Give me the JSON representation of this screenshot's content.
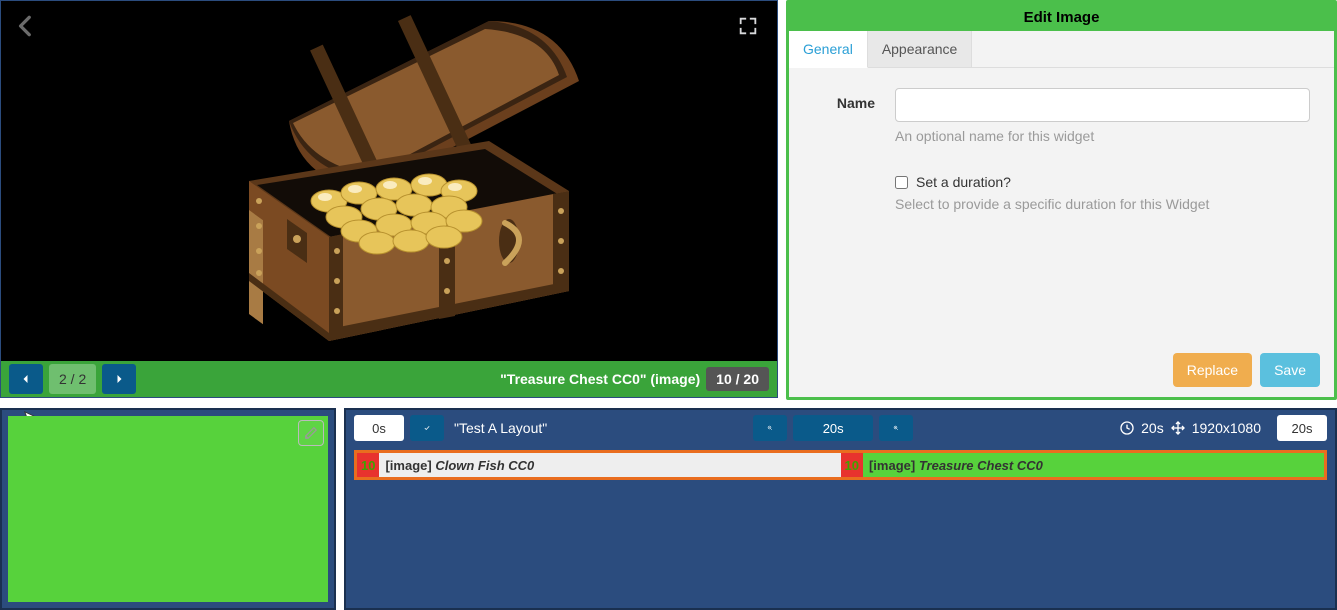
{
  "preview": {
    "page_indicator": "2 / 2",
    "item_title": "\"Treasure Chest CC0\" (image)",
    "item_count": "10 / 20"
  },
  "edit_panel": {
    "title": "Edit Image",
    "tabs": {
      "general": "General",
      "appearance": "Appearance"
    },
    "name_label": "Name",
    "name_value": "",
    "name_help": "An optional name for this widget",
    "duration_label": "Set a duration?",
    "duration_help": "Select to provide a specific duration for this Widget",
    "replace": "Replace",
    "save": "Save"
  },
  "timeline": {
    "start_time": "0s",
    "layout_title": "\"Test A Layout\"",
    "zoom_center": "20s",
    "total_duration": "20s",
    "resolution": "1920x1080",
    "end_time": "20s",
    "clips": [
      {
        "duration": "10",
        "type": "[image]",
        "name": "Clown Fish CC0",
        "active": false,
        "width_pct": 50
      },
      {
        "duration": "10",
        "type": "[image]",
        "name": "Treasure Chest CC0",
        "active": true,
        "width_pct": 50
      }
    ]
  }
}
